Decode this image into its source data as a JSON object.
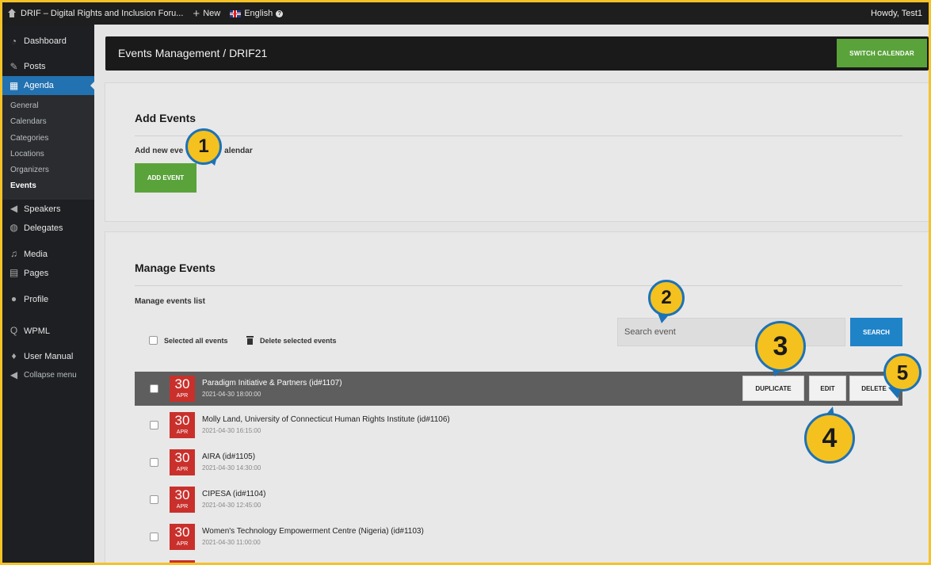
{
  "adminbar": {
    "site_name": "DRIF – Digital Rights and Inclusion Foru...",
    "new_label": "New",
    "language": "English",
    "howdy": "Howdy, Test1"
  },
  "sidebar": {
    "items": [
      {
        "label": "Dashboard",
        "icon": "dashboard-icon"
      },
      {
        "label": "Posts",
        "icon": "pin-icon"
      },
      {
        "label": "Agenda",
        "icon": "calendar-icon"
      },
      {
        "label": "Speakers",
        "icon": "megaphone-icon"
      },
      {
        "label": "Delegates",
        "icon": "globe-icon"
      },
      {
        "label": "Media",
        "icon": "media-icon"
      },
      {
        "label": "Pages",
        "icon": "pages-icon"
      },
      {
        "label": "Profile",
        "icon": "user-icon"
      },
      {
        "label": "WPML",
        "icon": "wpml-icon"
      },
      {
        "label": "User Manual",
        "icon": "bulb-icon"
      },
      {
        "label": "Collapse menu",
        "icon": "collapse-icon"
      }
    ],
    "agenda_submenu": [
      "General",
      "Calendars",
      "Categories",
      "Locations",
      "Organizers",
      "Events"
    ]
  },
  "header": {
    "title": "Events Management / DRIF21",
    "switch_label": "SWITCH CALENDAR"
  },
  "add_panel": {
    "title": "Add Events",
    "subtitle_start": "Add new eve",
    "subtitle_end": "alendar",
    "button_label": "ADD EVENT"
  },
  "manage_panel": {
    "title": "Manage Events",
    "subtitle": "Manage events list",
    "search_placeholder": "Search event",
    "search_label": "SEARCH",
    "select_all_label": "Selected all events",
    "delete_selected_label": "Delete selected events",
    "row_actions": {
      "duplicate": "DUPLICATE",
      "edit": "EDIT",
      "delete": "DELETE"
    },
    "events": [
      {
        "day": "30",
        "month": "APR",
        "title": "Paradigm Initiative & Partners (id#1107)",
        "time": "2021-04-30 18:00:00"
      },
      {
        "day": "30",
        "month": "APR",
        "title": "Molly Land, University of Connecticut Human Rights Institute (id#1106)",
        "time": "2021-04-30 16:15:00"
      },
      {
        "day": "30",
        "month": "APR",
        "title": "AIRA (id#1105)",
        "time": "2021-04-30 14:30:00"
      },
      {
        "day": "30",
        "month": "APR",
        "title": "CIPESA (id#1104)",
        "time": "2021-04-30 12:45:00"
      },
      {
        "day": "30",
        "month": "APR",
        "title": "Women's Technology Empowerment Centre (Nigeria) (id#1103)",
        "time": "2021-04-30 11:00:00"
      }
    ]
  },
  "callouts": [
    "1",
    "2",
    "3",
    "4",
    "5"
  ],
  "colors": {
    "accent_green": "#5aa33b",
    "accent_blue": "#1f83c8",
    "date_red": "#c9302c",
    "callout_yellow": "#f4c11f",
    "frame": "#f5c227"
  }
}
